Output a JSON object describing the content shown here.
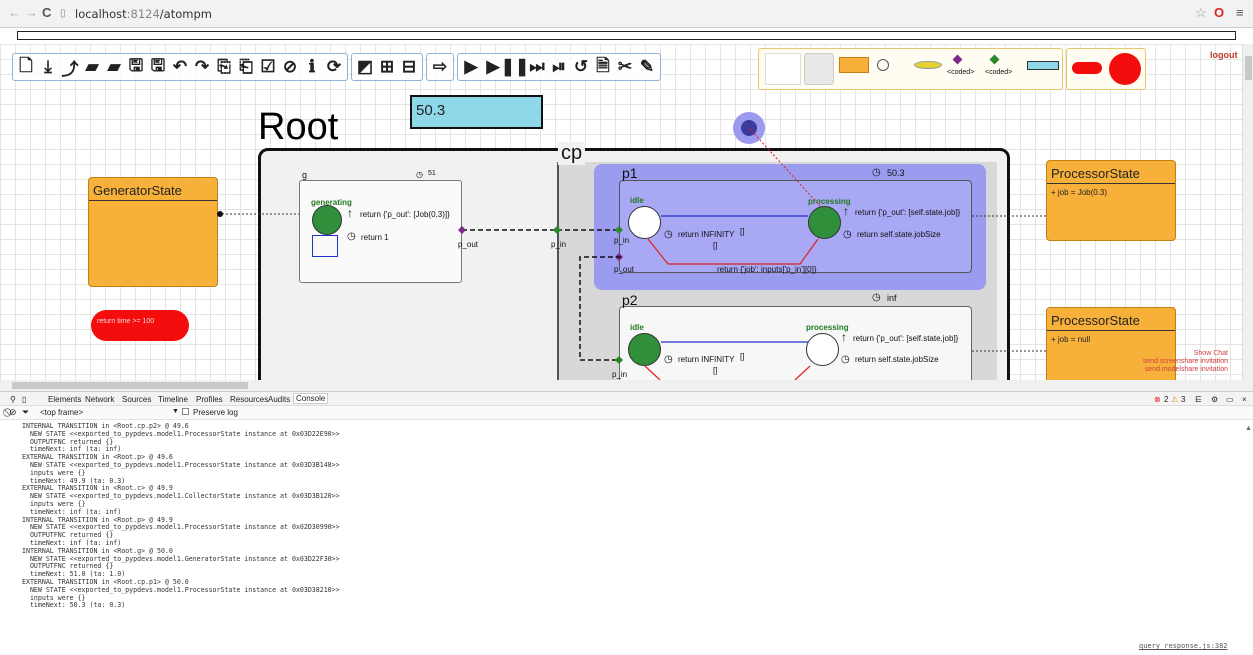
{
  "browser": {
    "host": "localhost",
    "port": ":8124",
    "path": "/atompm"
  },
  "canvas": {
    "root_title": "Root",
    "value_box": "50.3",
    "cp_label": "cp",
    "g_label": "g",
    "g_time": "51",
    "p1_label": "p1",
    "p1_time": "50.3",
    "p2_label": "p2",
    "p2_time": "inf",
    "gen_state": {
      "title": "GeneratorState"
    },
    "proc_state_1": {
      "title": "ProcessorState",
      "body": "+ job = Job(0.3)"
    },
    "proc_state_2": {
      "title": "ProcessorState",
      "body": "+ job = null"
    },
    "g_state": "generating",
    "g_output": "return {'p_out': [Job(0.3)]}",
    "g_timeout": "return 1",
    "p1_idle": "idle",
    "p1_proc": "processing",
    "p1_output": "return {'p_out': [self.state.job]}",
    "p1_idle_time": "return INFINITY",
    "p1_proc_time": "return self.state.jobSize",
    "p1_ext": "return {'job': inputs['p_in'][0]}",
    "p2_idle": "idle",
    "p2_proc": "processing",
    "p2_output": "return {'p_out': [self.state.job]}",
    "p2_idle_time": "return INFINITY",
    "p2_proc_time": "return self.state.jobSize",
    "port_p_out": "p_out",
    "port_p_in": "p_in",
    "port_p_in2": "p_in",
    "port_p_out2": "p_out",
    "port_p_in3": "p_in",
    "bracket": "[]",
    "end_condition": "return time >= 100",
    "palette_coded_1": "<coded>",
    "palette_coded_2": "<coded>",
    "logout": "logout",
    "chat": {
      "show": "Show Chat",
      "screenshare": "send screenshare invitation",
      "modelshare": "send modelshare invitation"
    }
  },
  "devtools": {
    "tabs": [
      "Elements",
      "Network",
      "Sources",
      "Timeline",
      "Profiles",
      "Resources",
      "Audits",
      "Console"
    ],
    "frame": "<top frame>",
    "preserve": "Preserve log",
    "errors": "2",
    "warnings": "3",
    "source_link": "query_response.js:382",
    "log": "INTERNAL TRANSITION in <Root.cp.p2> @ 49.6\n  NEW STATE <<exported_to_pypdevs.model1.ProcessorState instance at 0x03D22E90>>\n  OUTPUTFNC returned {}\n  timeNext: inf (ta: inf)\nEXTERNAL TRANSITION in <Root.p> @ 49.6\n  NEW STATE <<exported_to_pypdevs.model1.ProcessorState instance at 0x03D3B148>>\n  inputs were {}\n  timeNext: 49.9 (ta: 0.3)\nEXTERNAL TRANSITION in <Root.c> @ 49.9\n  NEW STATE <<exported_to_pypdevs.model1.CollectorState instance at 0x03D3B120>>\n  inputs were {}\n  timeNext: inf (ta: inf)\nINTERNAL TRANSITION in <Root.p> @ 49.9\n  NEW STATE <<exported_to_pypdevs.model1.ProcessorState instance at 0x02D30990>>\n  OUTPUTFNC returned {}\n  timeNext: inf (ta: inf)\nINTERNAL TRANSITION in <Root.g> @ 50.0\n  NEW STATE <<exported_to_pypdevs.model1.GeneratorState instance at 0x03D22F30>>\n  OUTPUTFNC returned {}\n  timeNext: 51.0 (ta: 1.0)\nEXTERNAL TRANSITION in <Root.cp.p1> @ 50.0\n  NEW STATE <<exported_to_pypdevs.model1.ProcessorState instance at 0x03D38210>>\n  inputs were {}\n  timeNext: 50.3 (ta: 0.3)"
  }
}
